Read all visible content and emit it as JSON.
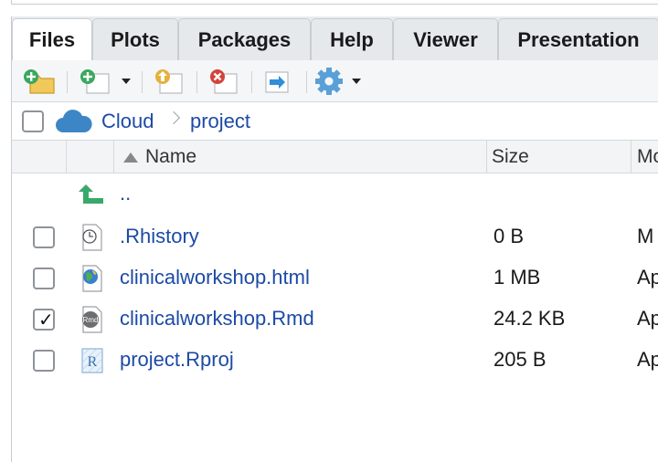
{
  "tabs": [
    {
      "label": "Files",
      "active": true
    },
    {
      "label": "Plots",
      "active": false
    },
    {
      "label": "Packages",
      "active": false
    },
    {
      "label": "Help",
      "active": false
    },
    {
      "label": "Viewer",
      "active": false
    },
    {
      "label": "Presentation",
      "active": false
    }
  ],
  "toolbar": {
    "icons": [
      "new-folder-icon",
      "new-blank-file-icon",
      "upload-icon",
      "delete-icon",
      "rename-icon",
      "more-gear-icon"
    ]
  },
  "breadcrumb": {
    "root": "Cloud",
    "current": "project"
  },
  "table": {
    "columns": {
      "name": "Name",
      "size": "Size",
      "modified": "Mo"
    },
    "parent": "..",
    "rows": [
      {
        "name": ".Rhistory",
        "size": "0 B",
        "modified": "M",
        "checked": false,
        "icon": "history-file-icon"
      },
      {
        "name": "clinicalworkshop.html",
        "size": "1 MB",
        "modified": "Ap",
        "checked": false,
        "icon": "html-file-icon"
      },
      {
        "name": "clinicalworkshop.Rmd",
        "size": "24.2 KB",
        "modified": "Ap",
        "checked": true,
        "icon": "rmd-file-icon"
      },
      {
        "name": "project.Rproj",
        "size": "205 B",
        "modified": "Ap",
        "checked": false,
        "icon": "rproj-file-icon"
      }
    ]
  },
  "colors": {
    "link": "#1c4aa6",
    "cloud": "#3d86c6",
    "parent_arrow": "#39a86b"
  }
}
